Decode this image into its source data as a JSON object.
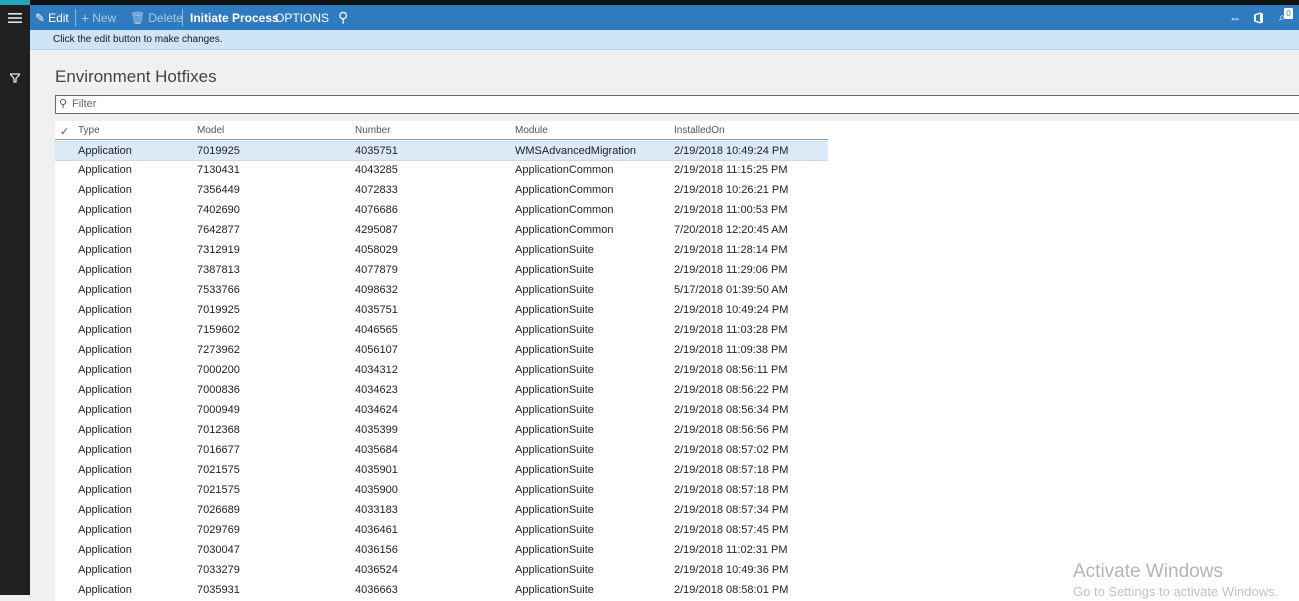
{
  "toolbar": {
    "edit_label": "Edit",
    "new_label": "New",
    "delete_label": "Delete",
    "initiate_label": "Initiate Process",
    "options_label": "OPTIONS",
    "notification_count": "0"
  },
  "banner": {
    "message": "Click the edit button to make changes."
  },
  "page": {
    "title": "Environment Hotfixes"
  },
  "filter": {
    "placeholder": "Filter"
  },
  "grid": {
    "headers": {
      "type": "Type",
      "model": "Model",
      "number": "Number",
      "module": "Module",
      "installed_on": "InstalledOn"
    },
    "rows": [
      {
        "type": "Application",
        "model": "7019925",
        "number": "4035751",
        "module": "WMSAdvancedMigration",
        "installed_on": "2/19/2018 10:49:24 PM"
      },
      {
        "type": "Application",
        "model": "7130431",
        "number": "4043285",
        "module": "ApplicationCommon",
        "installed_on": "2/19/2018 11:15:25 PM"
      },
      {
        "type": "Application",
        "model": "7356449",
        "number": "4072833",
        "module": "ApplicationCommon",
        "installed_on": "2/19/2018 10:26:21 PM"
      },
      {
        "type": "Application",
        "model": "7402690",
        "number": "4076686",
        "module": "ApplicationCommon",
        "installed_on": "2/19/2018 11:00:53 PM"
      },
      {
        "type": "Application",
        "model": "7642877",
        "number": "4295087",
        "module": "ApplicationCommon",
        "installed_on": "7/20/2018 12:20:45 AM"
      },
      {
        "type": "Application",
        "model": "7312919",
        "number": "4058029",
        "module": "ApplicationSuite",
        "installed_on": "2/19/2018 11:28:14 PM"
      },
      {
        "type": "Application",
        "model": "7387813",
        "number": "4077879",
        "module": "ApplicationSuite",
        "installed_on": "2/19/2018 11:29:06 PM"
      },
      {
        "type": "Application",
        "model": "7533766",
        "number": "4098632",
        "module": "ApplicationSuite",
        "installed_on": "5/17/2018 01:39:50 AM"
      },
      {
        "type": "Application",
        "model": "7019925",
        "number": "4035751",
        "module": "ApplicationSuite",
        "installed_on": "2/19/2018 10:49:24 PM"
      },
      {
        "type": "Application",
        "model": "7159602",
        "number": "4046565",
        "module": "ApplicationSuite",
        "installed_on": "2/19/2018 11:03:28 PM"
      },
      {
        "type": "Application",
        "model": "7273962",
        "number": "4056107",
        "module": "ApplicationSuite",
        "installed_on": "2/19/2018 11:09:38 PM"
      },
      {
        "type": "Application",
        "model": "7000200",
        "number": "4034312",
        "module": "ApplicationSuite",
        "installed_on": "2/19/2018 08:56:11 PM"
      },
      {
        "type": "Application",
        "model": "7000836",
        "number": "4034623",
        "module": "ApplicationSuite",
        "installed_on": "2/19/2018 08:56:22 PM"
      },
      {
        "type": "Application",
        "model": "7000949",
        "number": "4034624",
        "module": "ApplicationSuite",
        "installed_on": "2/19/2018 08:56:34 PM"
      },
      {
        "type": "Application",
        "model": "7012368",
        "number": "4035399",
        "module": "ApplicationSuite",
        "installed_on": "2/19/2018 08:56:56 PM"
      },
      {
        "type": "Application",
        "model": "7016677",
        "number": "4035684",
        "module": "ApplicationSuite",
        "installed_on": "2/19/2018 08:57:02 PM"
      },
      {
        "type": "Application",
        "model": "7021575",
        "number": "4035901",
        "module": "ApplicationSuite",
        "installed_on": "2/19/2018 08:57:18 PM"
      },
      {
        "type": "Application",
        "model": "7021575",
        "number": "4035900",
        "module": "ApplicationSuite",
        "installed_on": "2/19/2018 08:57:18 PM"
      },
      {
        "type": "Application",
        "model": "7026689",
        "number": "4033183",
        "module": "ApplicationSuite",
        "installed_on": "2/19/2018 08:57:34 PM"
      },
      {
        "type": "Application",
        "model": "7029769",
        "number": "4036461",
        "module": "ApplicationSuite",
        "installed_on": "2/19/2018 08:57:45 PM"
      },
      {
        "type": "Application",
        "model": "7030047",
        "number": "4036156",
        "module": "ApplicationSuite",
        "installed_on": "2/19/2018 11:02:31 PM"
      },
      {
        "type": "Application",
        "model": "7033279",
        "number": "4036524",
        "module": "ApplicationSuite",
        "installed_on": "2/19/2018 10:49:36 PM"
      },
      {
        "type": "Application",
        "model": "7035931",
        "number": "4036663",
        "module": "ApplicationSuite",
        "installed_on": "2/19/2018 08:58:01 PM"
      }
    ]
  },
  "watermark": {
    "line1": "Activate Windows",
    "line2": "Go to Settings to activate Windows."
  },
  "colors": {
    "toolbar": "#2f7bbf",
    "banner": "#cfe4f7",
    "selected_row": "#dce9f7",
    "rail": "#202020"
  }
}
